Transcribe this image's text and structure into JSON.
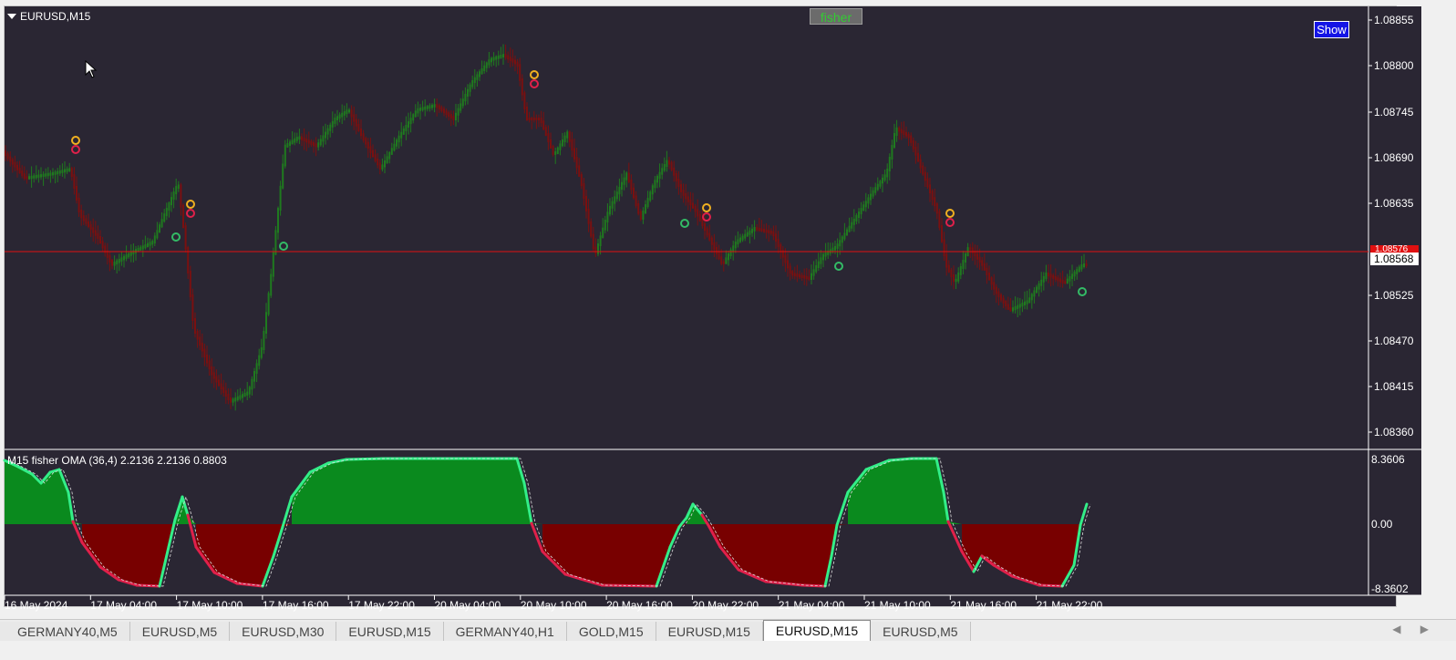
{
  "chart": {
    "symbol_title": "EURUSD,M15",
    "fisher_button": "fisher",
    "show_button": "Show",
    "current_price": "1.08568",
    "ask_price": "1.08576",
    "price_ticks": [
      "1.08855",
      "1.08800",
      "1.08745",
      "1.08690",
      "1.08635",
      "1.08525",
      "1.08470",
      "1.08415",
      "1.08360"
    ],
    "time_labels": [
      "16 May 2024",
      "17 May 04:00",
      "17 May 10:00",
      "17 May 16:00",
      "17 May 22:00",
      "20 May 04:00",
      "20 May 10:00",
      "20 May 16:00",
      "20 May 22:00",
      "21 May 04:00",
      "21 May 10:00",
      "21 May 16:00",
      "21 May 22:00"
    ],
    "colors": {
      "background": "#2a2633",
      "bull_candle": "#1f7a1f",
      "bear_candle": "#7a1010",
      "price_line": "#e01010",
      "indicator_positive": "#0a8a1e",
      "indicator_negative": "#780000",
      "indicator_line_up": "#33ee88",
      "indicator_line_down": "#e0204a"
    }
  },
  "indicator": {
    "title": "M15 fisher OMA (36,4) 2.2136 2.2136 0.8803",
    "ticks": [
      "8.3606",
      "0.00",
      "-8.3602"
    ]
  },
  "tabs": [
    {
      "label": "GERMANY40,M5",
      "active": false
    },
    {
      "label": "EURUSD,M5",
      "active": false
    },
    {
      "label": "EURUSD,M30",
      "active": false
    },
    {
      "label": "EURUSD,M15",
      "active": false
    },
    {
      "label": "GERMANY40,H1",
      "active": false
    },
    {
      "label": "GOLD,M15",
      "active": false
    },
    {
      "label": "EURUSD,M15",
      "active": false
    },
    {
      "label": "EURUSD,M15",
      "active": true
    },
    {
      "label": "EURUSD,M5",
      "active": false
    }
  ],
  "icons": {
    "scroll_left": "◀",
    "scroll_right": "▶"
  }
}
